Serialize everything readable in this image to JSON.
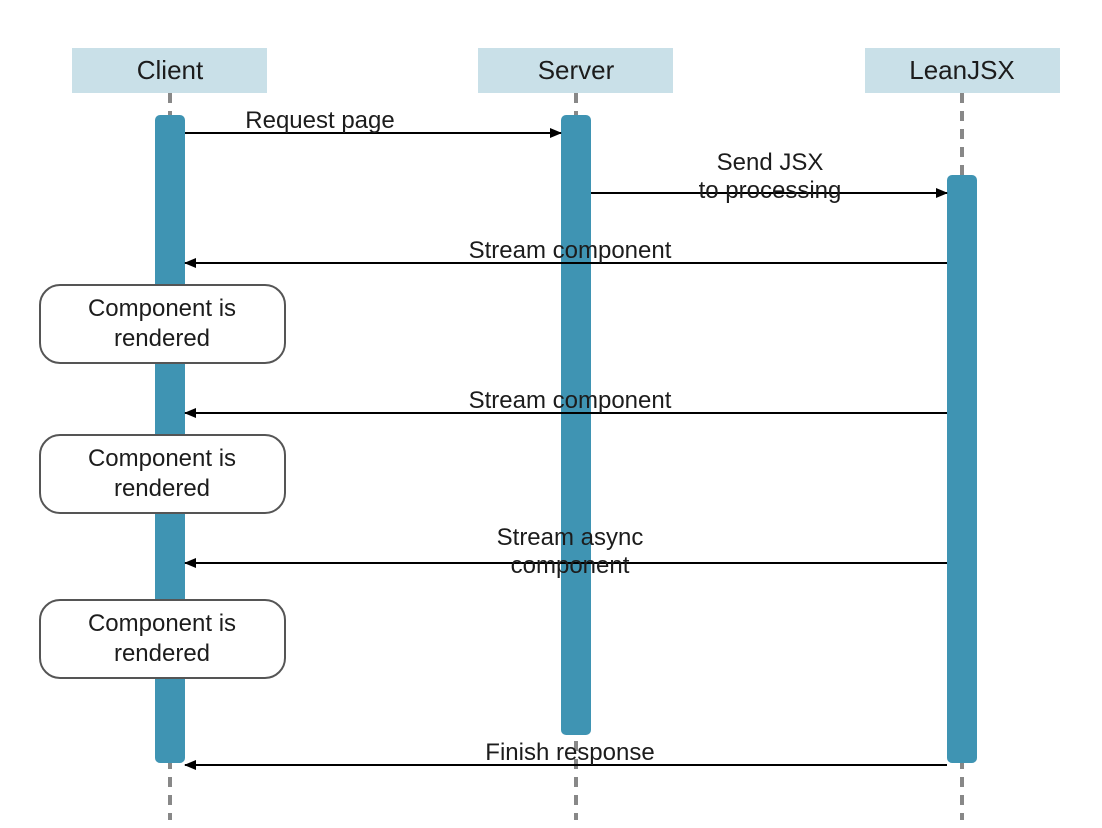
{
  "diagram": {
    "actors": {
      "client": "Client",
      "server": "Server",
      "leanjsx": "LeanJSX"
    },
    "messages": {
      "request_page": "Request page",
      "send_jsx_l1": "Send JSX",
      "send_jsx_l2": "to processing",
      "stream_component_1": "Stream component",
      "stream_component_2": "Stream component",
      "stream_async_l1": "Stream async",
      "stream_async_l2": "component",
      "finish_response": "Finish response"
    },
    "notes": {
      "rendered_1_l1": "Component is",
      "rendered_1_l2": "rendered",
      "rendered_2_l1": "Component is",
      "rendered_2_l2": "rendered",
      "rendered_3_l1": "Component is",
      "rendered_3_l2": "rendered"
    }
  }
}
